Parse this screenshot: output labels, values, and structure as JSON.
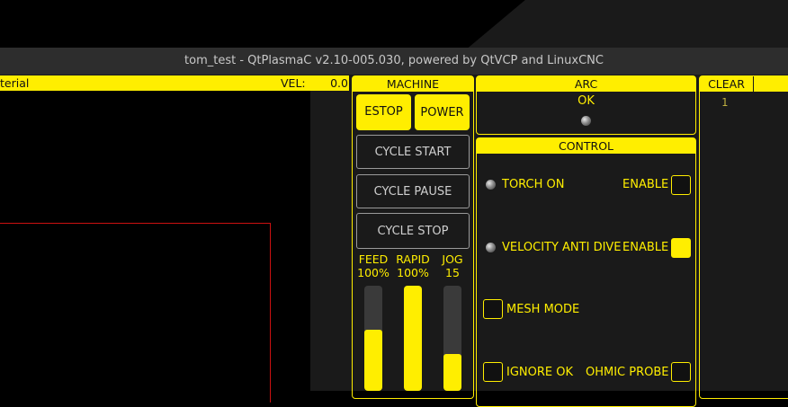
{
  "window": {
    "title": "tom_test - QtPlasmaC v2.10-005.030, powered by QtVCP and LinuxCNC"
  },
  "preview": {
    "material_label": "terial",
    "vel_label": "VEL:",
    "vel_value": "0.0"
  },
  "machine": {
    "header": "MACHINE",
    "estop_label": "ESTOP",
    "power_label": "POWER",
    "cycle_start_label": "CYCLE START",
    "cycle_pause_label": "CYCLE PAUSE",
    "cycle_stop_label": "CYCLE STOP",
    "overrides": [
      {
        "name": "FEED",
        "value": "100%",
        "level": 0.58
      },
      {
        "name": "RAPID",
        "value": "100%",
        "level": 1.0
      },
      {
        "name": "JOG",
        "value": "15",
        "level": 0.35
      }
    ]
  },
  "arc": {
    "header": "ARC",
    "status": "OK"
  },
  "control": {
    "header": "CONTROL",
    "torch_on_label": "TORCH ON",
    "torch_enable_label": "ENABLE",
    "torch_enable_checked": false,
    "vad_label": "VELOCITY ANTI DIVE",
    "vad_enable_label": "ENABLE",
    "vad_enable_checked": true,
    "mesh_mode_label": "MESH MODE",
    "mesh_mode_checked": false,
    "ignore_ok_label": "IGNORE OK",
    "ignore_ok_checked": false,
    "ohmic_probe_label": "OHMIC PROBE",
    "ohmic_probe_checked": false
  },
  "errors": {
    "clear_label": "CLEAR",
    "line_number": "1"
  },
  "colors": {
    "accent": "#ffee00",
    "panel_bg": "#1a1a1a",
    "preview_bg": "#000000",
    "path_red": "#cc1111"
  },
  "icons": [
    "led-indicator-icon",
    "checkbox-icon"
  ]
}
